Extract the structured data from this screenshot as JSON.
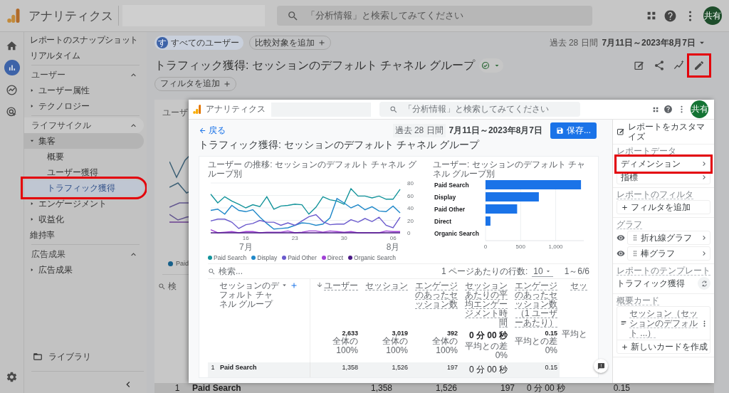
{
  "topbar": {
    "product": "アナリティクス",
    "search": {
      "placeholder": "「分析情報」と検索してみてください"
    },
    "avatar": "共有"
  },
  "rail": [
    {
      "kind": "home",
      "selected": false
    },
    {
      "kind": "reports",
      "selected": true
    },
    {
      "kind": "explore",
      "selected": false
    },
    {
      "kind": "advertising",
      "selected": false
    },
    {
      "kind": "settings",
      "selected": false
    }
  ],
  "nav": {
    "items": [
      {
        "kind": "link",
        "label": "レポートのスナップショット",
        "selected": false
      },
      {
        "kind": "link",
        "label": "リアルタイム",
        "selected": false
      },
      {
        "kind": "section",
        "label": "ユーザー",
        "expanded": true,
        "children": [
          {
            "kind": "group",
            "label": "ユーザー属性",
            "expanded": false,
            "selected": false
          },
          {
            "kind": "group",
            "label": "テクノロジー",
            "expanded": false,
            "selected": false
          }
        ]
      },
      {
        "kind": "section",
        "label": "ライフサイクル",
        "expanded": true,
        "children": [
          {
            "kind": "group",
            "label": "集客",
            "expanded": true,
            "selected": false,
            "children": [
              {
                "kind": "link",
                "label": "概要",
                "selected": false
              },
              {
                "kind": "link",
                "label": "ユーザー獲得",
                "selected": false
              },
              {
                "kind": "link",
                "label": "トラフィック獲得",
                "selected": true,
                "highlighted": true
              }
            ]
          },
          {
            "kind": "group",
            "label": "エンゲージメント",
            "expanded": false,
            "selected": false
          },
          {
            "kind": "group",
            "label": "収益化",
            "expanded": false,
            "selected": false
          },
          {
            "kind": "link",
            "label": "維持率",
            "selected": false
          }
        ]
      },
      {
        "kind": "section",
        "label": "広告成果",
        "expanded": true,
        "children": [
          {
            "kind": "group",
            "label": "広告成果",
            "expanded": false,
            "selected": false
          }
        ]
      }
    ],
    "library": "ライブラリ"
  },
  "header": {
    "segments": [
      {
        "kind": "segment",
        "avatar": "す",
        "label": "すべてのユーザー"
      },
      {
        "kind": "add",
        "label": "比較対象を追加"
      }
    ],
    "date_range": {
      "period": "過去 28 日間",
      "dates": "7月11日～2023年8月7日"
    },
    "title": "トラフィック獲得: セッションのデフォルト チャネル グループ",
    "verified": true,
    "filter_button": "フィルタを追加",
    "tools": [
      {
        "kind": "edit-report",
        "highlighted": false
      },
      {
        "kind": "share",
        "highlighted": false
      },
      {
        "kind": "insights",
        "highlighted": false
      },
      {
        "kind": "edit",
        "highlighted": true
      }
    ]
  },
  "background_card": {
    "title": "ユーザ",
    "legend": "Paid",
    "search_placeholder": "検"
  },
  "background_row": {
    "rank": "1",
    "channel": "Paid Search",
    "cells": [
      "1,358",
      "1,526",
      "197",
      "0 分 00 秒",
      "0.15"
    ]
  },
  "inner": {
    "topbar": {
      "product": "アナリティクス",
      "search": {
        "placeholder": "「分析情報」と検索してみてください"
      },
      "avatar": "共有"
    },
    "report": {
      "back": "戻る",
      "title": "トラフィック獲得: セッションのデフォルト チャネル グループ",
      "date_range": {
        "period": "過去 28 日間",
        "dates": "7月11日～2023年8月7日"
      },
      "save_button": "保存...",
      "line_chart": {
        "chart_data": {
          "type": "line",
          "grid": true,
          "annotations": [
            "7月",
            "8月"
          ],
          "title": "ユーザー の推移: セッションのデフォルト チャネル グループ別",
          "categories": [
            null,
            null,
            null,
            null,
            null,
            "16",
            null,
            null,
            null,
            null,
            null,
            null,
            "23",
            null,
            null,
            null,
            null,
            null,
            null,
            "30",
            null,
            null,
            null,
            null,
            null,
            null,
            "06",
            null
          ],
          "ylim": [
            0,
            80
          ],
          "yticks": [
            0,
            20,
            40,
            60,
            80
          ],
          "series": [
            {
              "name": "Paid Search",
              "color": "#12939a",
              "values": [
                62,
                48,
                58,
                51,
                46,
                40,
                45,
                42,
                58,
                38,
                43,
                44,
                46,
                45,
                30,
                41,
                58,
                53,
                51,
                46,
                71,
                59,
                59,
                56,
                59,
                54,
                54,
                70
              ]
            },
            {
              "name": "Display",
              "color": "#1f88c9",
              "values": [
                36,
                38,
                30,
                44,
                36,
                34,
                37,
                25,
                15,
                6,
                7,
                8,
                12,
                16,
                15,
                12,
                14,
                24,
                55,
                48,
                40,
                45,
                37,
                42,
                35,
                34,
                43,
                32
              ]
            },
            {
              "name": "Paid Other",
              "color": "#6a5acd",
              "values": [
                19,
                22,
                22,
                17,
                7,
                13,
                15,
                20,
                17,
                17,
                12,
                16,
                12,
                19,
                26,
                29,
                18,
                13,
                14,
                14,
                21,
                17,
                23,
                18,
                25,
                12,
                8,
                25
              ]
            },
            {
              "name": "Direct",
              "color": "#a142d6",
              "values": [
                5,
                0,
                1,
                2,
                0,
                2,
                2,
                0,
                1,
                1,
                1,
                3,
                0,
                1,
                3,
                3,
                1,
                3,
                2,
                1,
                2,
                0,
                0,
                0,
                0,
                3,
                2,
                2
              ]
            },
            {
              "name": "Organic Search",
              "color": "#4b1a86",
              "values": [
                0,
                0,
                0,
                0,
                0,
                0,
                0,
                0,
                0,
                0,
                0,
                0,
                0,
                0,
                0,
                0,
                0,
                0,
                0,
                0,
                0,
                0,
                0,
                0,
                0,
                0,
                0,
                0
              ]
            }
          ]
        }
      },
      "bar_chart": {
        "chart_data": {
          "type": "bar",
          "orientation": "horizontal",
          "title": "ユーザー: セッションのデフォルト チャネル グループ別",
          "categories": [
            "Paid Search",
            "Display",
            "Paid Other",
            "Direct",
            "Organic Search"
          ],
          "values": [
            1360,
            760,
            450,
            70,
            0
          ],
          "xlim": [
            0,
            1400
          ],
          "xticks": [
            {
              "value": 0,
              "label": "0"
            },
            {
              "value": 500,
              "label": "500"
            },
            {
              "value": 1000,
              "label": "1,000"
            }
          ]
        }
      },
      "table": {
        "search": {
          "placeholder": "検索..."
        },
        "rows_per_page_label": "1 ページあたりの行数:",
        "rows_per_page": "10",
        "page_range": "1～6/6",
        "columns": [
          {
            "kind": "dimension",
            "label": "セッションのデフォルト チャネル グループ"
          },
          {
            "kind": "metric",
            "label": "ユーザー",
            "sorted": true
          },
          {
            "kind": "metric",
            "label": "セッション",
            "sorted": false
          },
          {
            "kind": "metric",
            "label": "エンゲージのあったセッション数",
            "sorted": false
          },
          {
            "kind": "metric",
            "label": "セッションあたりの平均エンゲージメント時間",
            "sorted": false
          },
          {
            "kind": "metric",
            "label": "エンゲージのあったセッション数（1 ユーザーあたり）",
            "sorted": false
          },
          {
            "kind": "metric",
            "label": "セッ",
            "sorted": false
          }
        ],
        "totals": [
          {
            "value": "2,633",
            "note": "全体の 100%"
          },
          {
            "value": "3,019",
            "note": "全体の 100%"
          },
          {
            "value": "392",
            "note": "全体の 100%"
          },
          {
            "value": "0 分 00 秒",
            "note": "平均との差 0%"
          },
          {
            "value": "0.15",
            "note": "平均との差 0%"
          },
          {
            "note": "平均と"
          }
        ],
        "rows": [
          {
            "rank": "1",
            "cells": [
              "Paid Search",
              "1,358",
              "1,526",
              "197",
              "0 分 00 秒",
              "0.15"
            ]
          }
        ]
      }
    },
    "panel": {
      "title": "レポートをカスタマイズ",
      "sections": [
        {
          "label": "レポートデータ",
          "items": [
            {
              "kind": "nav",
              "label": "ディメンション",
              "highlighted": true
            },
            {
              "kind": "nav",
              "label": "指標",
              "highlighted": false
            }
          ]
        },
        {
          "label": "レポートのフィルタ",
          "items": [
            {
              "kind": "add",
              "label": "フィルタを追加"
            }
          ]
        },
        {
          "label": "グラフ",
          "items": [
            {
              "kind": "chart",
              "label": "折れ線グラフ",
              "visible": true
            },
            {
              "kind": "chart",
              "label": "棒グラフ",
              "visible": true
            }
          ]
        },
        {
          "label": "レポートのテンプレート",
          "items": [
            {
              "kind": "template",
              "label": "トラフィック獲得"
            }
          ]
        },
        {
          "label": "概要カード",
          "items": [
            {
              "kind": "card",
              "label": "セッション（セッションのデフォルト ...）"
            },
            {
              "kind": "add",
              "label": "新しいカードを作成"
            }
          ]
        }
      ]
    }
  }
}
